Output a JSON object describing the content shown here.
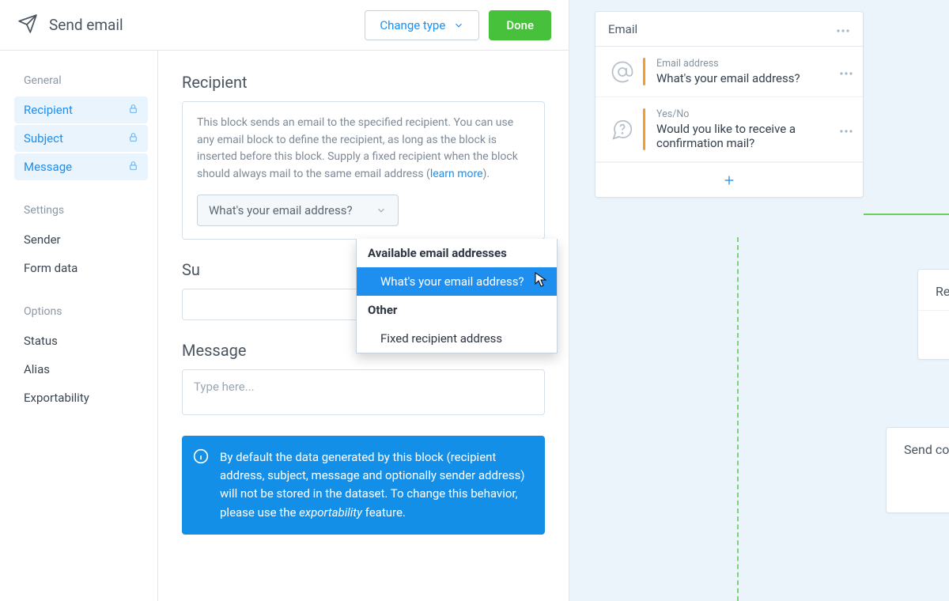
{
  "toolbar": {
    "title": "Send email",
    "change_type": "Change type",
    "done": "Done"
  },
  "sidebar": {
    "groups": {
      "general": "General",
      "settings": "Settings",
      "options": "Options"
    },
    "items": {
      "recipient": "Recipient",
      "subject": "Subject",
      "message": "Message",
      "sender": "Sender",
      "form_data": "Form data",
      "status": "Status",
      "alias": "Alias",
      "exportability": "Exportability"
    }
  },
  "recipient": {
    "heading": "Recipient",
    "help_a": "This block sends an email to the specified recipient. You can use any email block to define the recipient, as long as the block is inserted before this block. Supply a fixed recipient when the block should always mail to the same email address (",
    "help_link": "learn more",
    "help_b": ").",
    "select_value": "What's your email address?",
    "dropdown": {
      "group1": "Available email addresses",
      "opt1": "What's your email address?",
      "group2": "Other",
      "opt2": "Fixed recipient address"
    }
  },
  "subject": {
    "heading": "Su"
  },
  "message": {
    "heading": "Message",
    "placeholder": "Type here..."
  },
  "banner": {
    "a": "By default the data generated by this block (recipient address, subject, message and optionally sender address) will not be stored in the dataset. To change this behavior, please use the ",
    "b": "exportability",
    "c": " feature."
  },
  "preview": {
    "title": "Email",
    "row1_label": "Email address",
    "row1_value": "What's your email address?",
    "row2_label": "Yes/No",
    "row2_value": "Would you like to receive a confirmation mail?"
  },
  "mini": {
    "a": "Re",
    "b": "Send co"
  }
}
